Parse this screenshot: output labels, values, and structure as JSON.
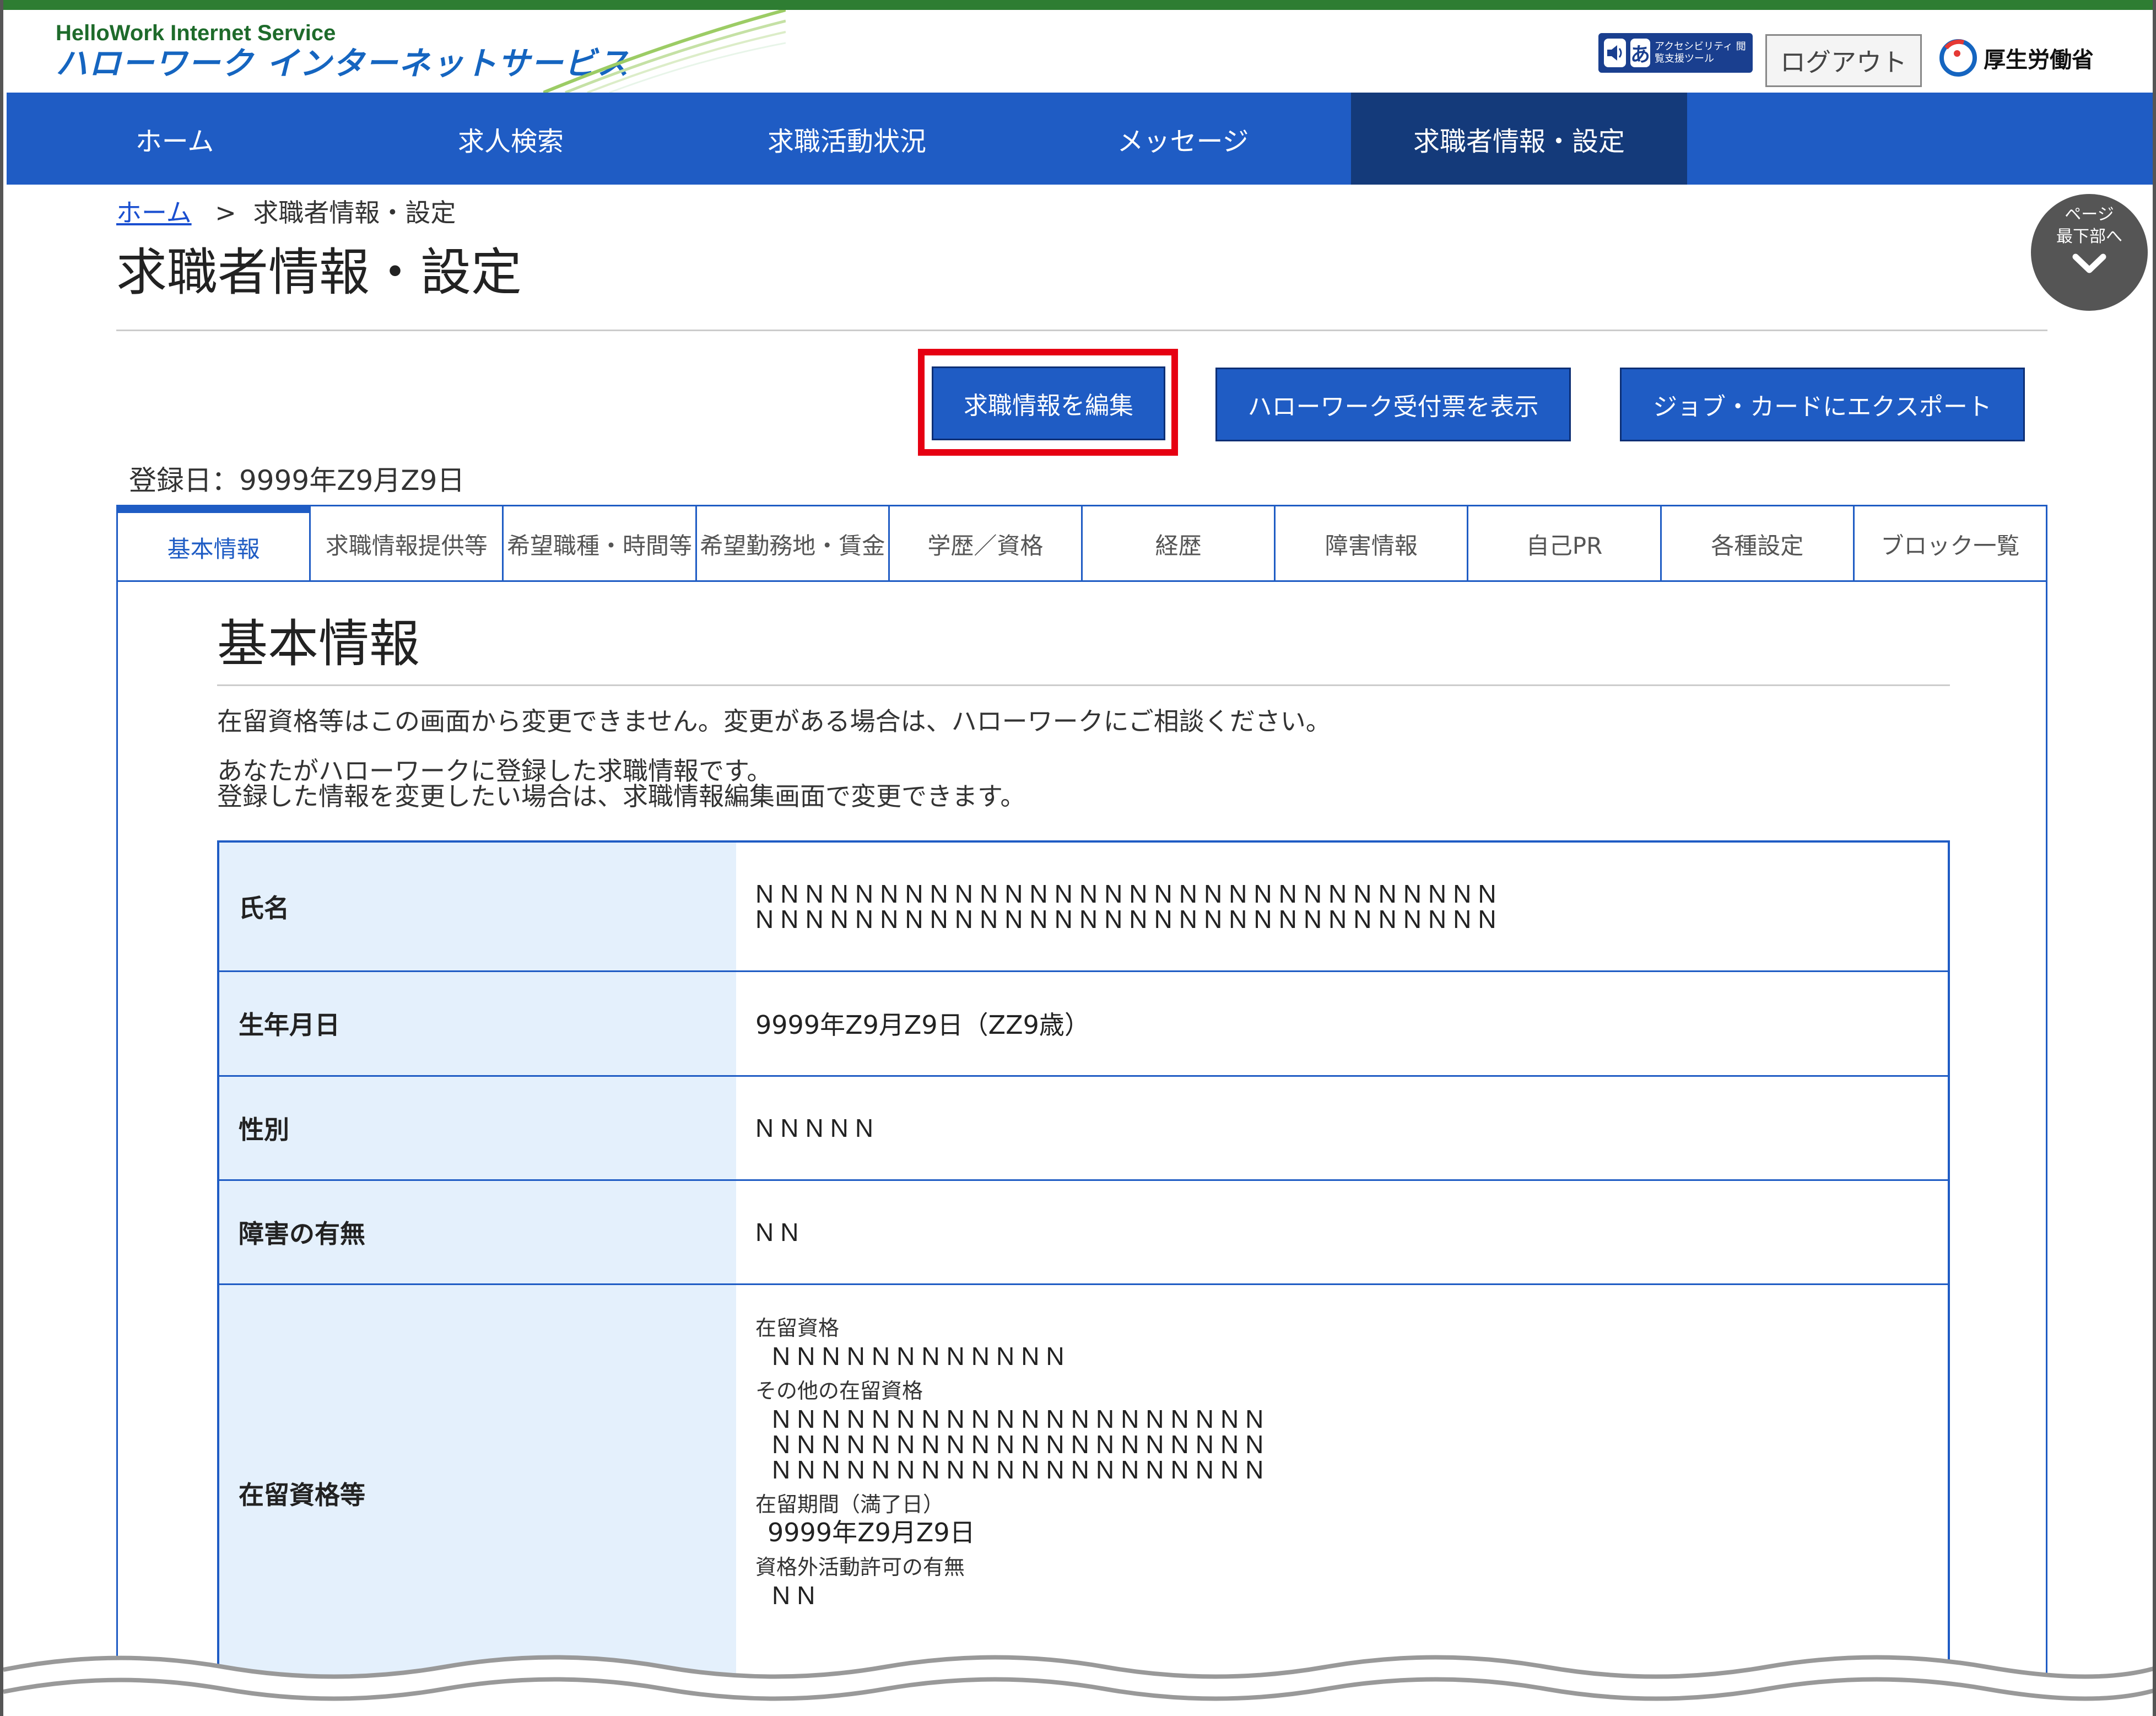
{
  "header": {
    "logo_en": "HelloWork Internet Service",
    "logo_jp": "ハローワーク インターネットサービス",
    "accessibility_tool": "アクセシビリティ 閲覧支援ツール",
    "logout": "ログアウト",
    "ministry": "厚生労働省"
  },
  "nav": [
    "ホーム",
    "求人検索",
    "求職活動状況",
    "メッセージ",
    "求職者情報・設定"
  ],
  "breadcrumb": {
    "home": "ホーム",
    "sep": ">",
    "current": "求職者情報・設定"
  },
  "page_title": "求職者情報・設定",
  "scroll_bottom": {
    "line1": "ページ",
    "line2": "最下部へ"
  },
  "actions": {
    "edit": "求職情報を編集",
    "receipt": "ハローワーク受付票を表示",
    "export": "ジョブ・カードにエクスポート"
  },
  "registration_date": "登録日：9999年Z9月Z9日",
  "tabs": [
    "基本情報",
    "求職情報提供等",
    "希望職種・時間等",
    "希望勤務地・賃金",
    "学歴／資格",
    "経歴",
    "障害情報",
    "自己PR",
    "各種設定",
    "ブロック一覧"
  ],
  "section": {
    "title": "基本情報",
    "note1": "在留資格等はこの画面から変更できません。変更がある場合は、ハローワークにご相談ください。",
    "note2a": "あなたがハローワークに登録した求職情報です。",
    "note2b": "登録した情報を変更したい場合は、求職情報編集画面で変更できます。"
  },
  "table": {
    "name_label": "氏名",
    "name_line1": "NNNNNNNNNNNNNNNNNNNNNNNNNNNNNN",
    "name_line2": "NNNNNNNNNNNNNNNNNNNNNNNNNNNNNN",
    "birth_label": "生年月日",
    "birth_value": "9999年Z9月Z9日（ZZ9歳）",
    "gender_label": "性別",
    "gender_value": "NNNNN",
    "disability_label": "障害の有無",
    "disability_value": "NN",
    "residence_label": "在留資格等",
    "residence_status_label": "在留資格",
    "residence_status_value": "NNNNNNNNNNNN",
    "other_status_label": "その他の在留資格",
    "other_status_line1": "NNNNNNNNNNNNNNNNNNNN",
    "other_status_line2": "NNNNNNNNNNNNNNNNNNNN",
    "other_status_line3": "NNNNNNNNNNNNNNNNNNNN",
    "period_label": "在留期間（満了日）",
    "period_value": "9999年Z9月Z9日",
    "permission_label": "資格外活動許可の有無",
    "permission_value": "NN"
  }
}
